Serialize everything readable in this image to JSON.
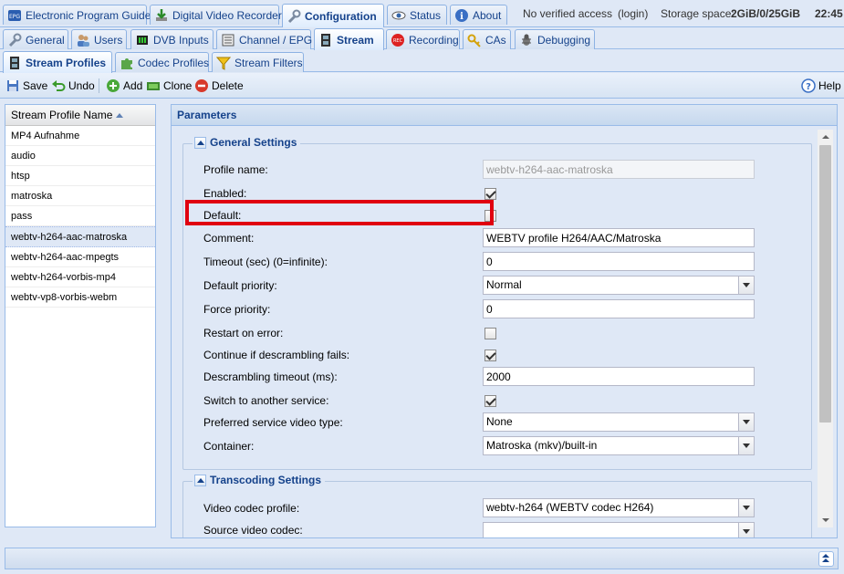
{
  "main_tabs": [
    {
      "label": "Electronic Program Guide",
      "icon": "epg-icon"
    },
    {
      "label": "Digital Video Recorder",
      "icon": "download-icon"
    },
    {
      "label": "Configuration",
      "icon": "wrench-icon",
      "active": true
    },
    {
      "label": "Status",
      "icon": "eye-icon"
    },
    {
      "label": "About",
      "icon": "info-icon"
    }
  ],
  "header": {
    "access": "No verified access",
    "login": "(login)",
    "storage_label": "Storage space:",
    "storage_value": "2GiB/0/25GiB",
    "time": "22:45"
  },
  "config_tabs": [
    {
      "label": "General",
      "icon": "wrench-icon"
    },
    {
      "label": "Users",
      "icon": "users-icon"
    },
    {
      "label": "DVB Inputs",
      "icon": "dvb-icon"
    },
    {
      "label": "Channel / EPG",
      "icon": "channel-icon"
    },
    {
      "label": "Stream",
      "icon": "film-icon",
      "active": true
    },
    {
      "label": "Recording",
      "icon": "rec-icon"
    },
    {
      "label": "CAs",
      "icon": "key-icon"
    },
    {
      "label": "Debugging",
      "icon": "bug-icon"
    }
  ],
  "stream_tabs": [
    {
      "label": "Stream Profiles",
      "icon": "film-icon",
      "active": true
    },
    {
      "label": "Codec Profiles",
      "icon": "puzzle-icon"
    },
    {
      "label": "Stream Filters",
      "icon": "filter-icon"
    }
  ],
  "toolbar": {
    "save": "Save",
    "undo": "Undo",
    "add": "Add",
    "clone": "Clone",
    "delete": "Delete",
    "help": "Help"
  },
  "grid": {
    "column": "Stream Profile Name",
    "rows": [
      "MP4 Aufnahme",
      "audio",
      "htsp",
      "matroska",
      "pass",
      "webtv-h264-aac-matroska",
      "webtv-h264-aac-mpegts",
      "webtv-h264-vorbis-mp4",
      "webtv-vp8-vorbis-webm"
    ],
    "selected_index": 5
  },
  "params": {
    "title": "Parameters",
    "general": {
      "legend": "General Settings",
      "profile_name_label": "Profile name:",
      "profile_name_value": "webtv-h264-aac-matroska",
      "enabled_label": "Enabled:",
      "enabled": true,
      "default_label": "Default:",
      "default": false,
      "comment_label": "Comment:",
      "comment_value": "WEBTV profile H264/AAC/Matroska",
      "timeout_label": "Timeout (sec) (0=infinite):",
      "timeout_value": "0",
      "priority_label": "Default priority:",
      "priority_value": "Normal",
      "force_priority_label": "Force priority:",
      "force_priority_value": "0",
      "restart_label": "Restart on error:",
      "restart": false,
      "continue_label": "Continue if descrambling fails:",
      "continue": true,
      "descramble_timeout_label": "Descrambling timeout (ms):",
      "descramble_timeout_value": "2000",
      "switch_label": "Switch to another service:",
      "switch": true,
      "video_type_label": "Preferred service video type:",
      "video_type_value": "None",
      "container_label": "Container:",
      "container_value": "Matroska (mkv)/built-in"
    },
    "transcoding": {
      "legend": "Transcoding Settings",
      "video_codec_label": "Video codec profile:",
      "video_codec_value": "webtv-h264 (WEBTV codec H264)",
      "source_codec_label": "Source video codec:"
    }
  },
  "colors": {
    "accent": "#15428b",
    "highlight_box": "#e00010",
    "panel_bg": "#dfe8f6",
    "border": "#99bbe8"
  }
}
